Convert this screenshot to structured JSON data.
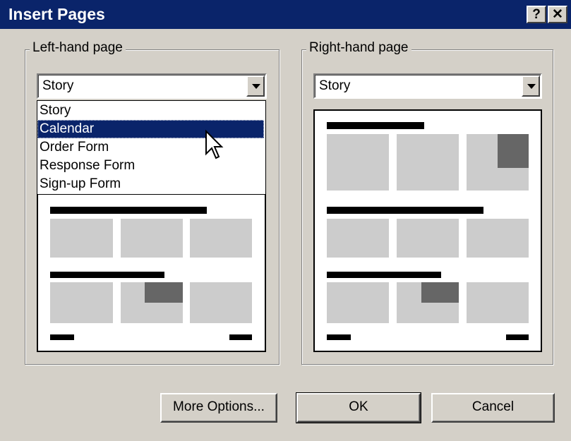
{
  "window": {
    "title": "Insert Pages",
    "help_label": "?",
    "close_label": "✕"
  },
  "left": {
    "legend": "Left-hand page",
    "selected": "Story",
    "dropdown_open": true,
    "options": [
      "Story",
      "Calendar",
      "Order Form",
      "Response Form",
      "Sign-up Form"
    ],
    "highlighted": "Calendar"
  },
  "right": {
    "legend": "Right-hand page",
    "selected": "Story"
  },
  "buttons": {
    "more_options": "More Options...",
    "ok": "OK",
    "cancel": "Cancel"
  },
  "colors": {
    "titlebar": "#0a246a",
    "face": "#d4d0c8",
    "highlight": "#0a246a",
    "layout_light": "#cccccc",
    "layout_dark": "#666666"
  },
  "icons": {
    "dropdown": "chevron-down-icon",
    "pointer": "mouse-pointer-icon"
  }
}
